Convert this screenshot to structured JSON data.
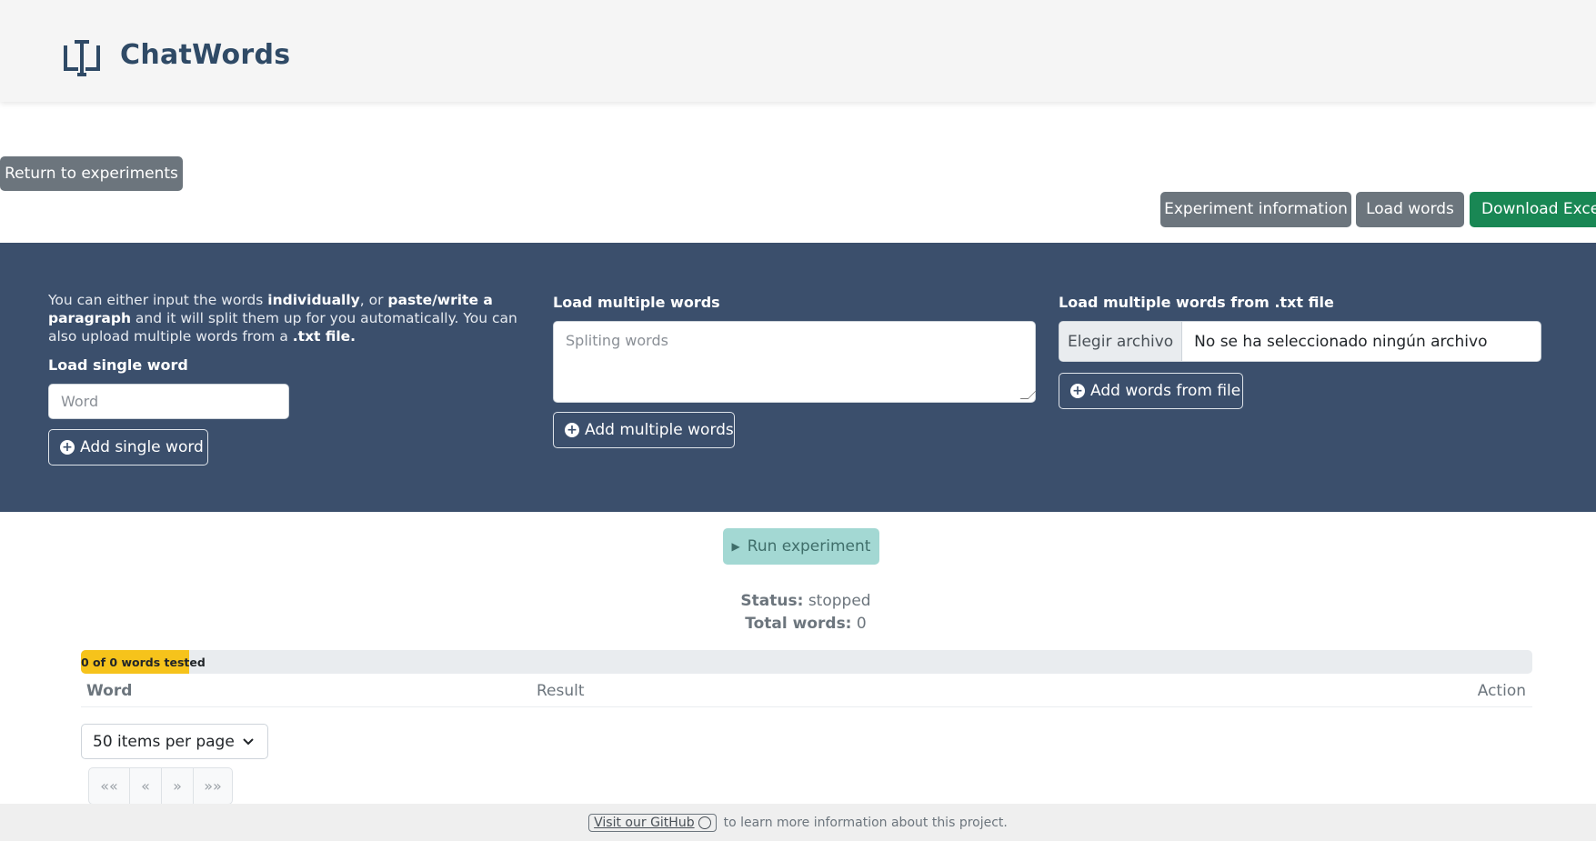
{
  "app": {
    "title": "ChatWords"
  },
  "nav": {
    "return_label": "Return to experiments",
    "experiment_info_label": "Experiment information",
    "load_words_label": "Load words",
    "download_excel_label": "Download Excel"
  },
  "loader": {
    "intro": {
      "p1": "You can either input the words ",
      "b1": "individually",
      "p2": ", or ",
      "b2": "paste/write a paragraph",
      "p3": " and it will split them up for you automatically. You can also upload multiple words from a ",
      "b3": ".txt file."
    },
    "single": {
      "label": "Load single word",
      "placeholder": "Word",
      "button": "Add single word"
    },
    "multiple": {
      "label": "Load multiple words",
      "placeholder": "Spliting words",
      "button": "Add multiple words"
    },
    "file": {
      "label": "Load multiple words from .txt file",
      "choose_label": "Elegir archivo",
      "no_file": "No se ha seleccionado ningún archivo",
      "button": "Add words from file"
    }
  },
  "run": {
    "label": "Run experiment"
  },
  "status": {
    "status_label": "Status:",
    "status_value": "stopped",
    "total_label": "Total words:",
    "total_value": "0"
  },
  "progress": {
    "text": "0 of 0 words tested",
    "fraction": 0
  },
  "table": {
    "columns": [
      "Word",
      "Result",
      "Action"
    ]
  },
  "pagination": {
    "per_page": "50 items per page",
    "buttons": [
      "««",
      "«",
      "»",
      "»»"
    ]
  },
  "footer": {
    "link": "Visit our GitHub",
    "text": "to learn more information about this project."
  },
  "colors": {
    "panel": "#3b4f6c",
    "brand": "#2f4a66",
    "success": "#198754",
    "secondary": "#6c757d",
    "progress": "#f6c31b"
  },
  "icons": [
    "brand-logo-icon",
    "plus-circle-icon",
    "play-icon",
    "chevron-down-icon",
    "github-icon"
  ]
}
